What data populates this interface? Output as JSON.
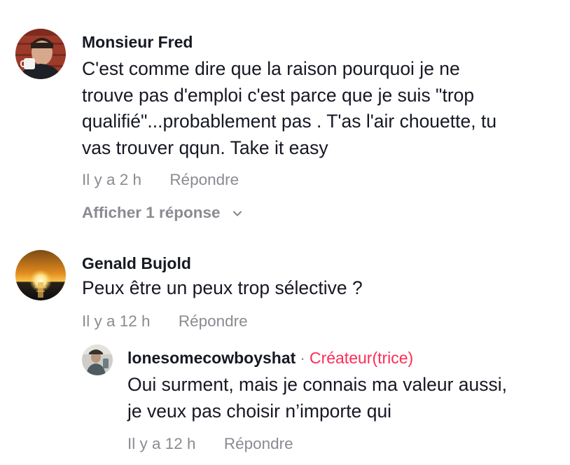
{
  "comments": [
    {
      "author": "Monsieur Fred",
      "text_lines": [
        "C'est comme dire que la raison pourquoi je ne",
        "trouve pas d'emploi c'est parce que je suis \"trop",
        "qualifié\"...probablement pas . T'as l'air chouette, tu",
        "vas trouver qqun. Take it easy"
      ],
      "time": "Il y a 2 h",
      "reply_label": "Répondre",
      "view_replies_label": "Afficher 1 réponse"
    },
    {
      "author": "Genald Bujold",
      "text_lines": [
        "Peux être un peux trop sélective ?"
      ],
      "time": "Il y a 12 h",
      "reply_label": "Répondre",
      "replies": [
        {
          "author": "lonesomecowboyshat",
          "separator": "·",
          "badge": "Créateur(trice)",
          "text_lines": [
            "Oui surment, mais je connais ma valeur aussi,",
            "je veux pas choisir n’importe qui"
          ],
          "time": "Il y a 12 h",
          "reply_label": "Répondre"
        }
      ]
    }
  ],
  "colors": {
    "text": "#161823",
    "muted": "#8a8b91",
    "creator_badge": "#fe2c55"
  },
  "icons": {
    "view_replies": "chevron-down-icon"
  }
}
